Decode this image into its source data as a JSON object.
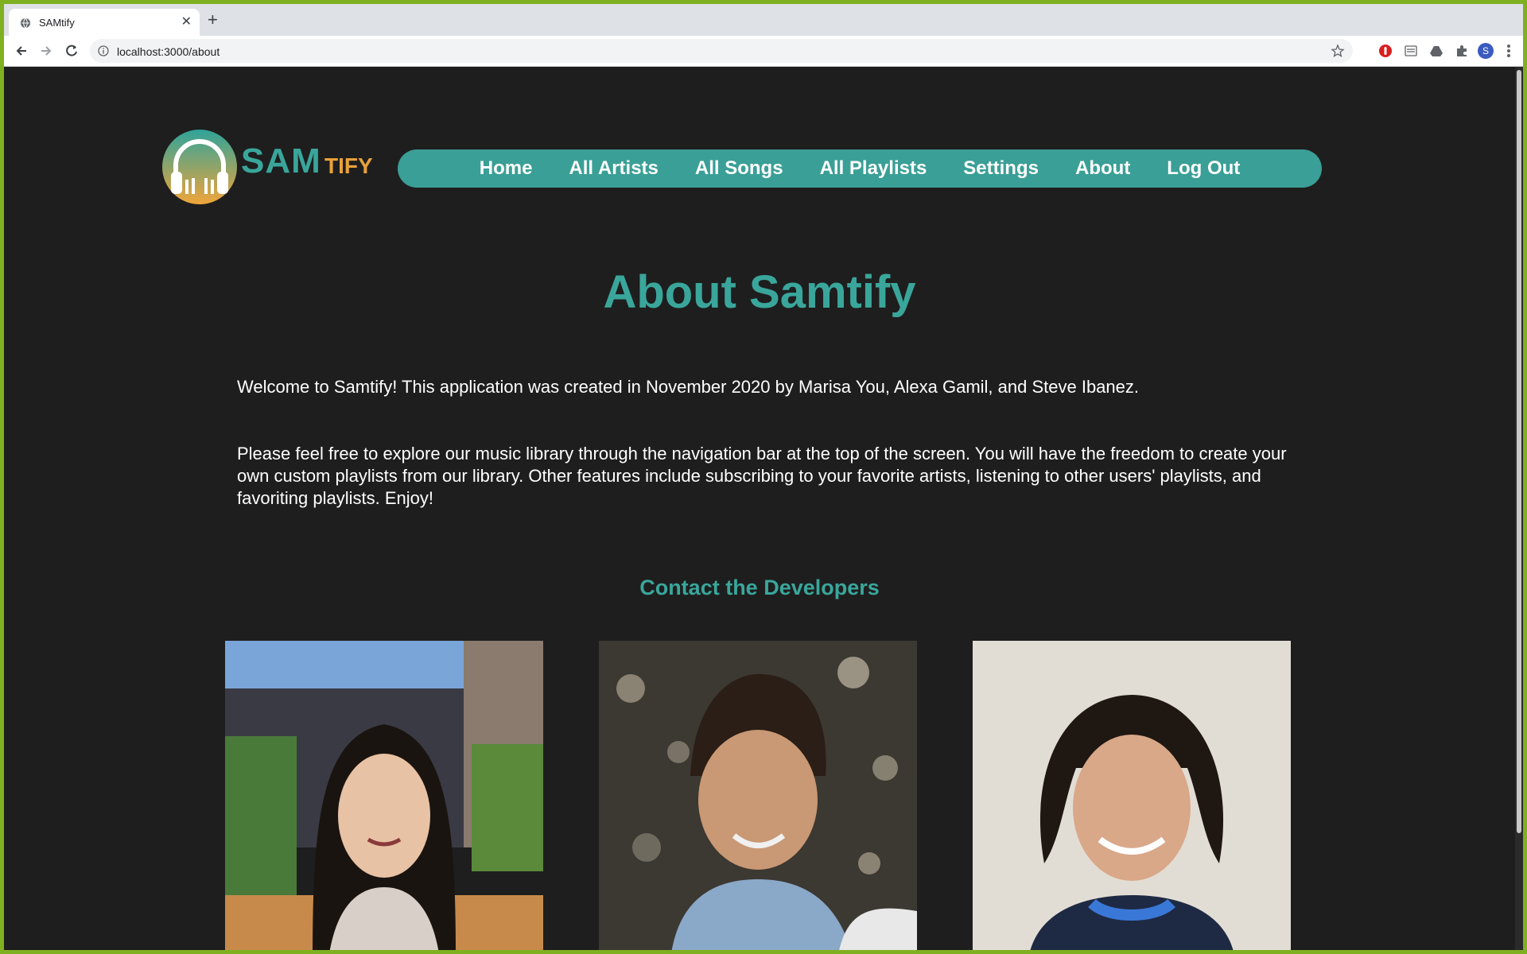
{
  "browser": {
    "tab_title": "SAMtify",
    "url": "localhost:3000/about",
    "profile_initial": "S"
  },
  "logo": {
    "sam": "SAM",
    "tify": "TIFY"
  },
  "nav": {
    "items": [
      {
        "label": "Home"
      },
      {
        "label": "All Artists"
      },
      {
        "label": "All Songs"
      },
      {
        "label": "All Playlists"
      },
      {
        "label": "Settings"
      },
      {
        "label": "About"
      },
      {
        "label": "Log Out"
      }
    ]
  },
  "about": {
    "title": "About Samtify",
    "welcome": "Welcome to Samtify! This application was created in November 2020 by Marisa You, Alexa Gamil, and Steve Ibanez.",
    "description": "Please feel free to explore our music library through the navigation bar at the top of the screen. You will have the freedom to create your own custom playlists from our library. Other features include subscribing to your favorite artists, listening to other users' playlists, and favoriting playlists. Enjoy!",
    "contact_heading": "Contact the Developers"
  },
  "colors": {
    "accent": "#3aa69b",
    "nav_bg": "#3a9f96",
    "logo_orange": "#e8a13a",
    "page_bg": "#1e1e1e"
  }
}
